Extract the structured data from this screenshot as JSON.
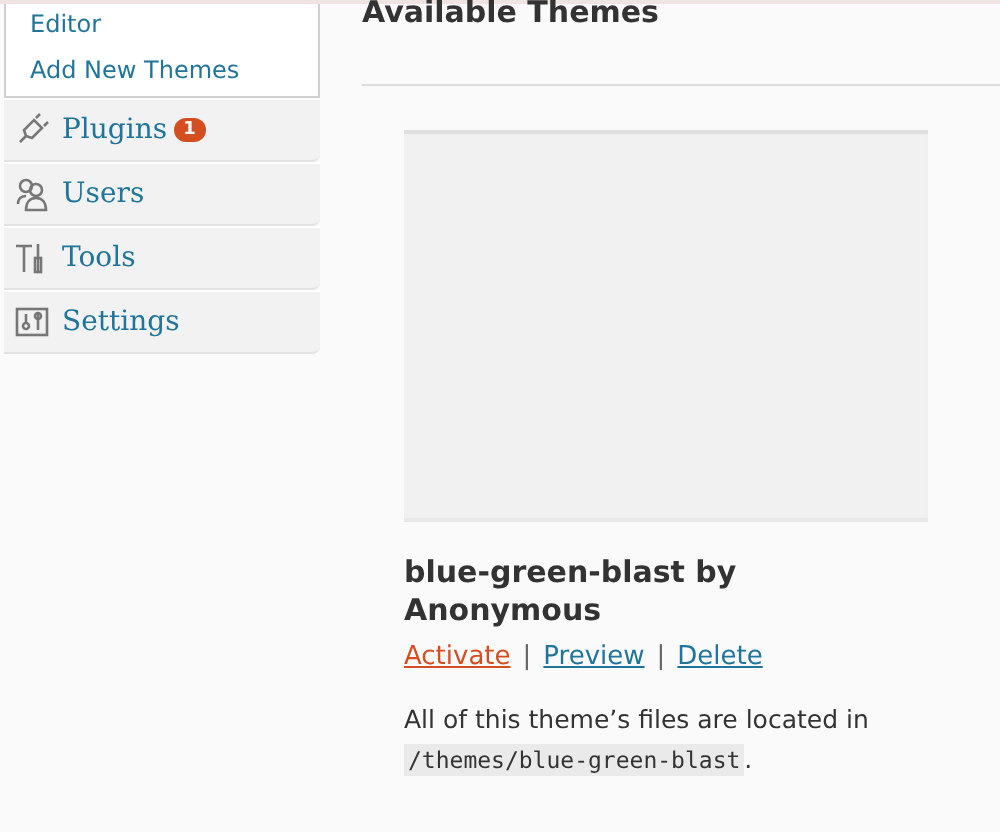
{
  "sidebar": {
    "submenu": [
      {
        "label": "Editor"
      },
      {
        "label": "Add New Themes"
      }
    ],
    "items": [
      {
        "kind": "plugins",
        "label": "Plugins",
        "badge": "1"
      },
      {
        "kind": "users",
        "label": "Users"
      },
      {
        "kind": "tools",
        "label": "Tools"
      },
      {
        "kind": "settings",
        "label": "Settings"
      }
    ]
  },
  "main": {
    "heading": "Available Themes",
    "theme": {
      "title": "blue-green-blast by Anonymous",
      "actions": [
        {
          "label": "Activate",
          "kind": "primary"
        },
        {
          "label": "Preview",
          "kind": "normal"
        },
        {
          "label": "Delete",
          "kind": "normal"
        }
      ],
      "separator": "|",
      "location_text": "All of this theme’s files are located in",
      "path": "/themes/blue-green-blast",
      "end": "."
    }
  }
}
